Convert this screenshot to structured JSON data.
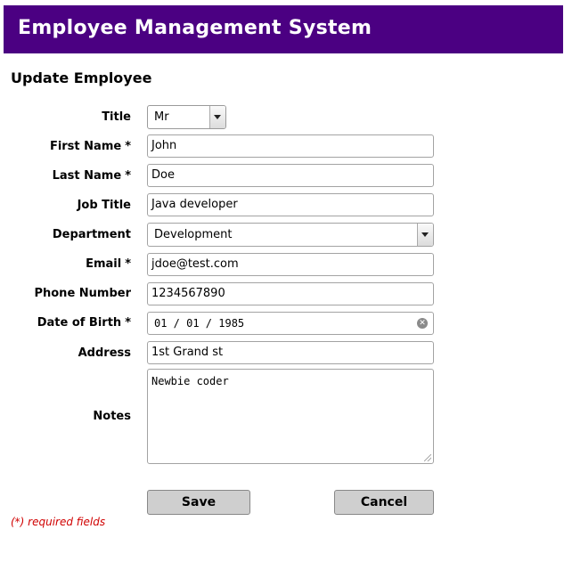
{
  "header": {
    "title": "Employee Management System"
  },
  "form": {
    "title": "Update Employee",
    "fields": {
      "title": {
        "label": "Title",
        "value": "Mr"
      },
      "first_name": {
        "label": "First Name",
        "required_mark": "*",
        "value": "John"
      },
      "last_name": {
        "label": "Last Name",
        "required_mark": "*",
        "value": "Doe"
      },
      "job_title": {
        "label": "Job Title",
        "value": "Java developer"
      },
      "department": {
        "label": "Department",
        "value": "Development"
      },
      "email": {
        "label": "Email",
        "required_mark": "*",
        "value": "jdoe@test.com"
      },
      "phone": {
        "label": "Phone Number",
        "value": "1234567890"
      },
      "dob": {
        "label": "Date of Birth",
        "required_mark": "*",
        "value": "01 / 01 / 1985"
      },
      "address": {
        "label": "Address",
        "value": "1st Grand st"
      },
      "notes": {
        "label": "Notes",
        "value": "Newbie coder"
      }
    },
    "buttons": {
      "save": "Save",
      "cancel": "Cancel"
    },
    "required_note": "(*) required fields"
  },
  "colors": {
    "header_bg": "#4b0082",
    "required_note": "#d00000",
    "button_bg": "#cfcfcf"
  }
}
